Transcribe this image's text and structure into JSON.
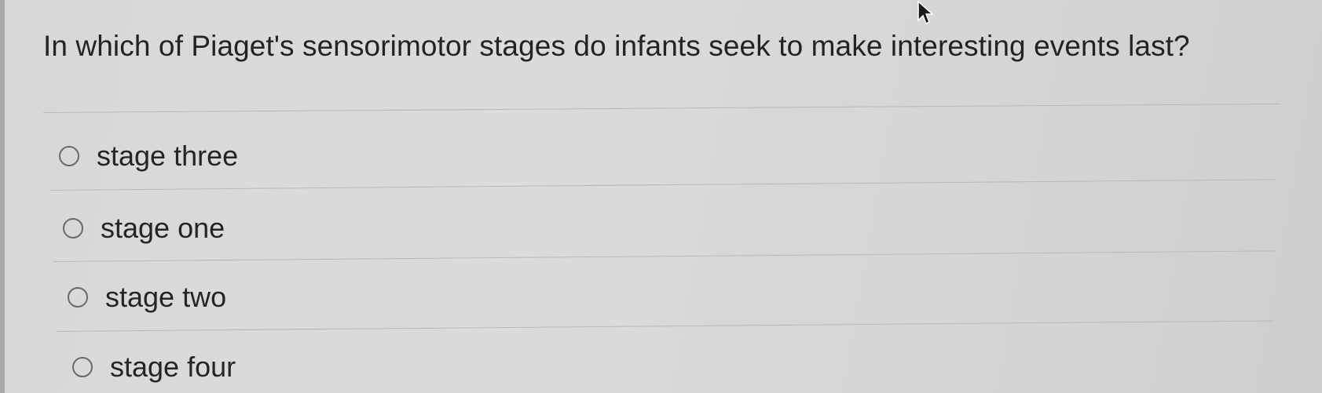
{
  "question": {
    "text": "In which of Piaget's sensorimotor stages do infants seek to make interesting events last?"
  },
  "options": [
    {
      "label": "stage three",
      "selected": false
    },
    {
      "label": "stage one",
      "selected": false
    },
    {
      "label": "stage two",
      "selected": false
    },
    {
      "label": "stage four",
      "selected": false
    }
  ],
  "icons": {
    "cursor": "arrow-cursor-icon"
  }
}
